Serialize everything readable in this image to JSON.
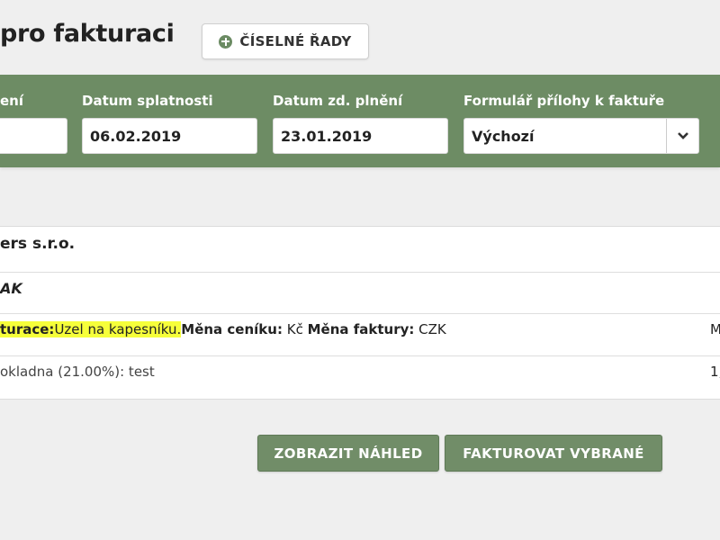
{
  "header": {
    "title_fragment": "pro fakturaci",
    "series_button_label": "ČÍSELNÉ ŘADY"
  },
  "form": {
    "fields": [
      {
        "label": "ení",
        "value": ""
      },
      {
        "label": "Datum splatnosti",
        "value": "06.02.2019"
      },
      {
        "label": "Datum zd. plnění",
        "value": "23.01.2019"
      },
      {
        "label": "Formulář přílohy k faktuře",
        "value": "Výchozí"
      }
    ]
  },
  "table": {
    "company": "ers s.r.o.",
    "code": "AK",
    "info": {
      "invoicing_label": "turace:",
      "invoicing_value": "Uzel na kapesníku.",
      "price_list_currency_label": "Měna ceníku:",
      "price_list_currency_value": "Kč",
      "invoice_currency_label": "Měna faktury:",
      "invoice_currency_value": "CZK",
      "right_clip": "M"
    },
    "item": {
      "text": "okladna (21.00%): test",
      "right_clip": "1,"
    }
  },
  "actions": {
    "preview_label": "ZOBRAZIT NÁHLED",
    "invoice_selected_label": "FAKTUROVAT VYBRANÉ"
  },
  "colors": {
    "accent_green": "#6d8c64",
    "highlight": "#f6ff3a"
  }
}
